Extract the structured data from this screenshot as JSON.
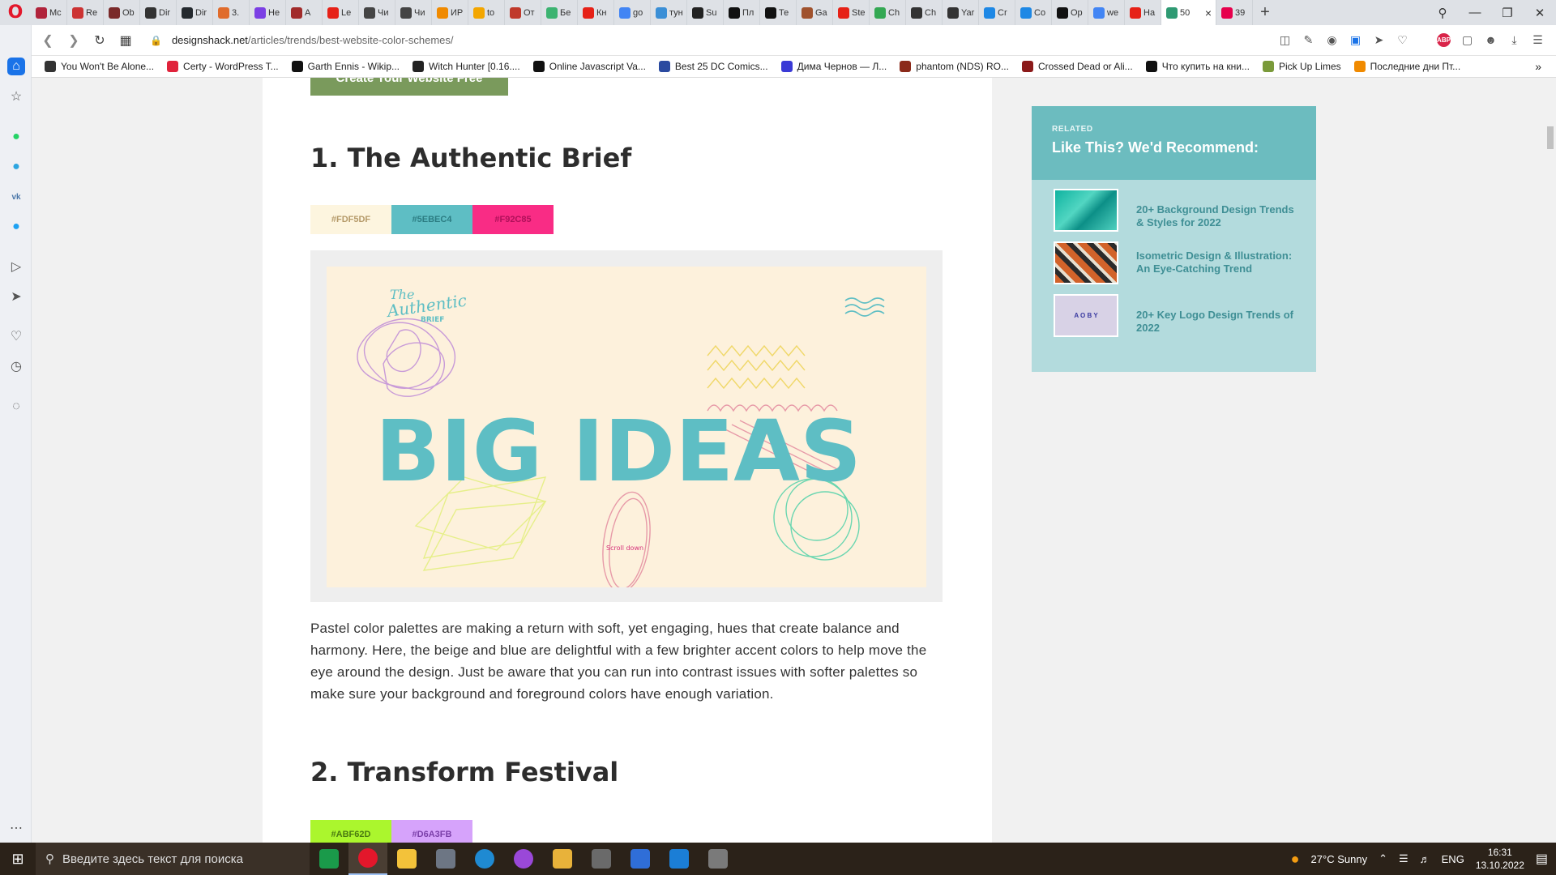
{
  "browser": {
    "tabs": [
      {
        "label": "Mc",
        "color": "#b0233b"
      },
      {
        "label": "Re",
        "color": "#c33"
      },
      {
        "label": "Ob",
        "color": "#7a2a2a"
      },
      {
        "label": "Dir",
        "color": "#333"
      },
      {
        "label": "Dir",
        "color": "#24292e"
      },
      {
        "label": "3.",
        "color": "#e06c2c"
      },
      {
        "label": "He",
        "color": "#7b3fe4"
      },
      {
        "label": "A",
        "color": "#a12b2b"
      },
      {
        "label": "Le",
        "color": "#e62117"
      },
      {
        "label": "Чи",
        "color": "#444"
      },
      {
        "label": "Чи",
        "color": "#444"
      },
      {
        "label": "ИР",
        "color": "#f08a00"
      },
      {
        "label": "to",
        "color": "#f3a600"
      },
      {
        "label": "От",
        "color": "#c0392b"
      },
      {
        "label": "Бе",
        "color": "#3cb371"
      },
      {
        "label": "Кн",
        "color": "#e62117"
      },
      {
        "label": "go",
        "color": "#4285f4"
      },
      {
        "label": "тун",
        "color": "#3b8fd6"
      },
      {
        "label": "Su",
        "color": "#222"
      },
      {
        "label": "Пл",
        "color": "#111"
      },
      {
        "label": "Те",
        "color": "#111"
      },
      {
        "label": "Ga",
        "color": "#a0522d"
      },
      {
        "label": "Ste",
        "color": "#e62117"
      },
      {
        "label": "Ch",
        "color": "#34a853"
      },
      {
        "label": "Ch",
        "color": "#333"
      },
      {
        "label": "Yar",
        "color": "#333"
      },
      {
        "label": "Cr",
        "color": "#1e88e5"
      },
      {
        "label": "Co",
        "color": "#1e88e5"
      },
      {
        "label": "Op",
        "color": "#111"
      },
      {
        "label": "we",
        "color": "#4285f4"
      },
      {
        "label": "На",
        "color": "#e62117"
      },
      {
        "label": "50",
        "color": "#2f9a73",
        "active": true
      },
      {
        "label": "39",
        "color": "#e6004c"
      }
    ],
    "new_tab": "+",
    "url_domain": "designshack.net",
    "url_path": "/articles/trends/best-website-color-schemes/",
    "adblock_label": "ABP",
    "bookmarks": [
      {
        "label": "You Won't Be Alone...",
        "color": "#333"
      },
      {
        "label": "Certy - WordPress T...",
        "color": "#e0233b"
      },
      {
        "label": "Garth Ennis - Wikip...",
        "color": "#111"
      },
      {
        "label": "Witch Hunter [0.16....",
        "color": "#222"
      },
      {
        "label": "Online Javascript Va...",
        "color": "#111"
      },
      {
        "label": "Best 25 DC Comics...",
        "color": "#2a4aa0"
      },
      {
        "label": "Дима Чернов — Л...",
        "color": "#3a3ad6"
      },
      {
        "label": "phantom (NDS) RO...",
        "color": "#8b2a1a"
      },
      {
        "label": "Crossed Dead or Ali...",
        "color": "#8b1a1a"
      },
      {
        "label": "Что купить на кни...",
        "color": "#111"
      },
      {
        "label": "Pick Up Limes",
        "color": "#7a9a3a"
      },
      {
        "label": "Последние дни Пт...",
        "color": "#f08a00"
      }
    ],
    "more_label": "»"
  },
  "article": {
    "cta_label": "Create Your Website Free",
    "section1_title": "1. The Authentic Brief",
    "section1_swatches": [
      {
        "hex": "#FDF5DF",
        "text_color": "#b59a6a",
        "bg": "#fdf5df"
      },
      {
        "hex": "#5EBEC4",
        "text_color": "#2c7d83",
        "bg": "#5ebec4"
      },
      {
        "hex": "#F92C85",
        "text_color": "#b0105a",
        "bg": "#f92c85"
      }
    ],
    "art": {
      "logo_line1": "The",
      "logo_line2": "Authentic",
      "logo_line3": "BRIEF",
      "headline": "BIG IDEAS",
      "scroll_text": "Scroll down"
    },
    "paragraph": "Pastel color palettes are making a return with soft, yet engaging, hues that create balance and harmony. Here, the beige and blue are delightful with a few brighter accent colors to help move the eye around the design. Just be aware that you can run into contrast issues with softer palettes so make sure your background and foreground colors have enough variation.",
    "section2_title": "2. Transform Festival",
    "section2_swatches": [
      {
        "hex": "#ABF62D",
        "text_color": "#4a7a10",
        "bg": "#abf62d"
      },
      {
        "hex": "#D6A3FB",
        "text_color": "#7a3fa8",
        "bg": "#d6a3fb"
      }
    ]
  },
  "related": {
    "kicker": "RELATED",
    "title": "Like This? We'd Recommend:",
    "items": [
      {
        "label": "20+ Background Design Trends & Styles for 2022"
      },
      {
        "label": "Isometric Design & Illustration: An Eye-Catching Trend"
      },
      {
        "label": "20+ Key Logo Design Trends of 2022"
      }
    ],
    "thumb3_text": "A O B Y"
  },
  "taskbar": {
    "search_placeholder": "Введите здесь текст для поиска",
    "weather": "27°C  Sunny",
    "lang": "ENG",
    "time": "16:31",
    "date": "13.10.2022"
  }
}
